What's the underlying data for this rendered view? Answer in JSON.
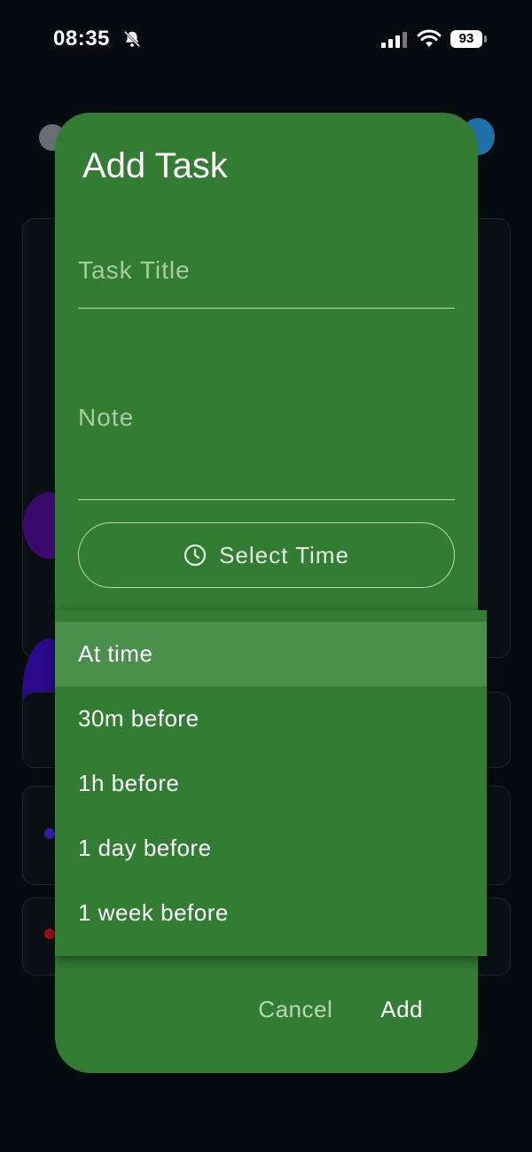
{
  "status_bar": {
    "time": "08:35",
    "battery": "93"
  },
  "dialog": {
    "title": "Add Task",
    "task_title_placeholder": "Task Title",
    "note_placeholder": "Note",
    "select_time_label": "Select Time",
    "cancel_label": "Cancel",
    "add_label": "Add"
  },
  "reminder_menu": {
    "options": [
      "At time",
      "30m before",
      "1h before",
      "1 day before",
      "1 week before"
    ],
    "selected": "At time"
  },
  "colors": {
    "dialog_bg": "#327c34",
    "menu_selected": "#4a8f4c",
    "app_bg": "#060b10"
  }
}
